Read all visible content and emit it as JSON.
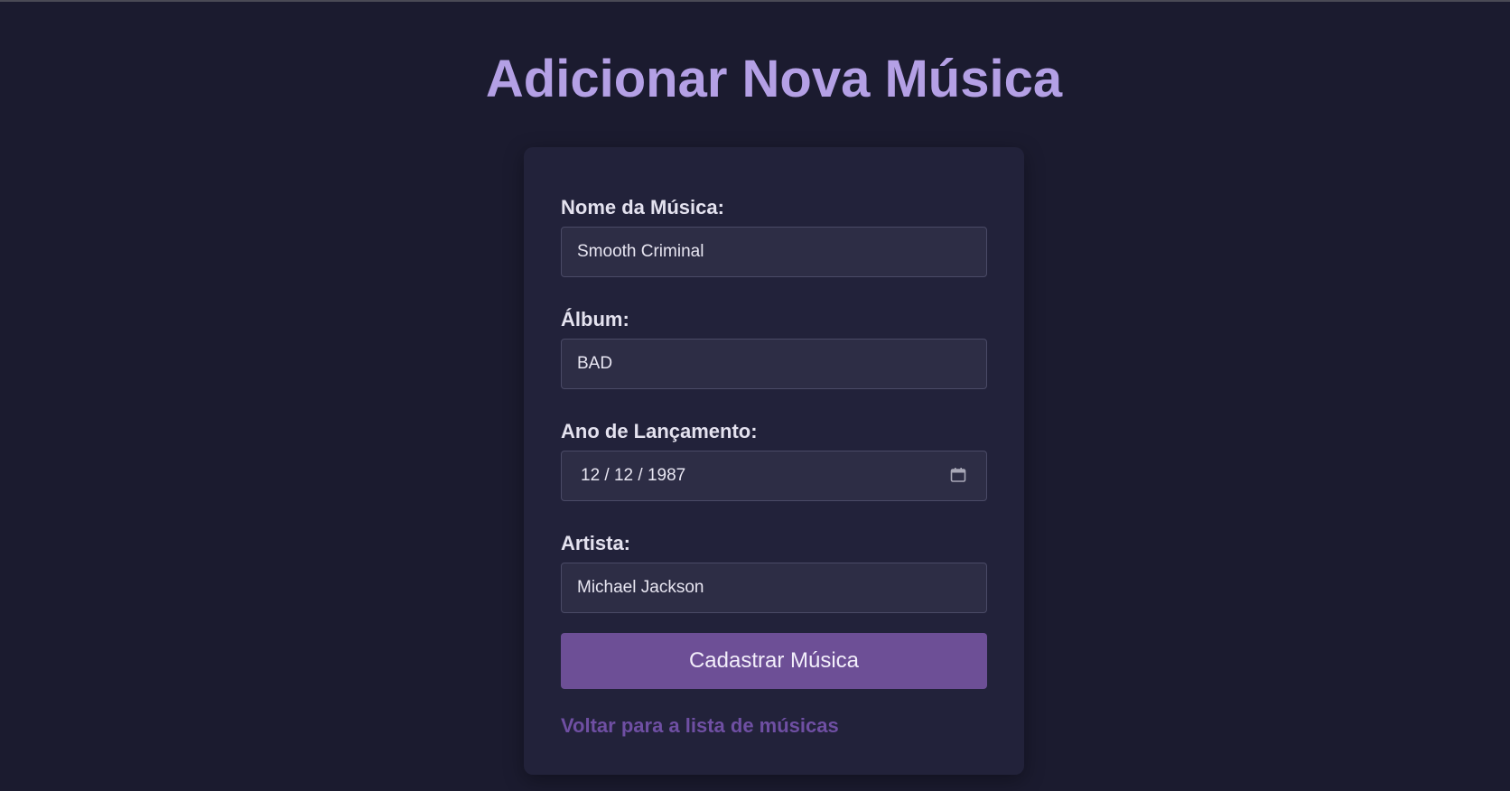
{
  "page": {
    "title": "Adicionar Nova Música"
  },
  "form": {
    "song_name": {
      "label": "Nome da Música:",
      "value": "Smooth Criminal"
    },
    "album": {
      "label": "Álbum:",
      "value": "BAD"
    },
    "release_year": {
      "label": "Ano de Lançamento:",
      "value": "12 / 12 / 1987"
    },
    "artist": {
      "label": "Artista:",
      "value": "Michael Jackson"
    },
    "submit_label": "Cadastrar Música",
    "back_link_label": "Voltar para a lista de músicas"
  },
  "icons": {
    "date_picker": "calendar-icon"
  },
  "colors": {
    "background": "#1b1b2f",
    "card": "#22223a",
    "title": "#b4a0e5",
    "button": "#6d4f96",
    "link": "#6f4fa3"
  }
}
